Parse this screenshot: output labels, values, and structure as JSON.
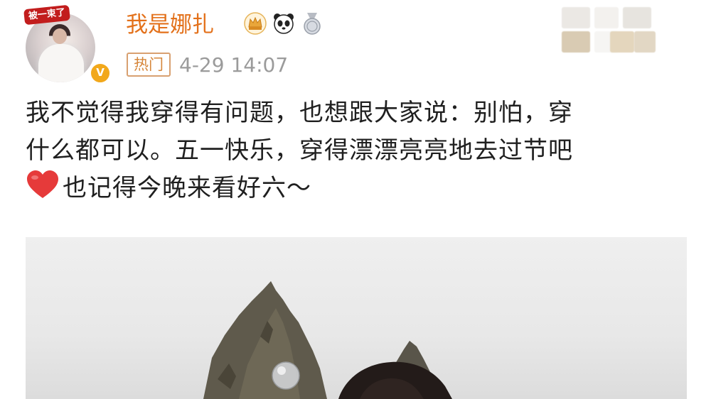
{
  "author": {
    "name": "我是娜扎",
    "avatar_sticker": "被一束了",
    "verified_badge": "V",
    "badges": [
      "crown-badge-icon",
      "panda-badge-icon",
      "medal-badge-icon"
    ],
    "colors": {
      "name": "#e3711b",
      "verified": "#f2a81b"
    }
  },
  "meta": {
    "hot_tag": "热门",
    "timestamp": "4-29 14:07"
  },
  "post": {
    "lines": [
      "我不觉得我穿得有问题，也想跟大家说：别怕，穿",
      "什么都可以。五一快乐，穿得漂漂亮亮地去过节吧",
      "也记得今晚来看好六～"
    ],
    "emoji": "heart-emoji-icon"
  },
  "image": {
    "description_icon": "photo-rock-landscape"
  }
}
